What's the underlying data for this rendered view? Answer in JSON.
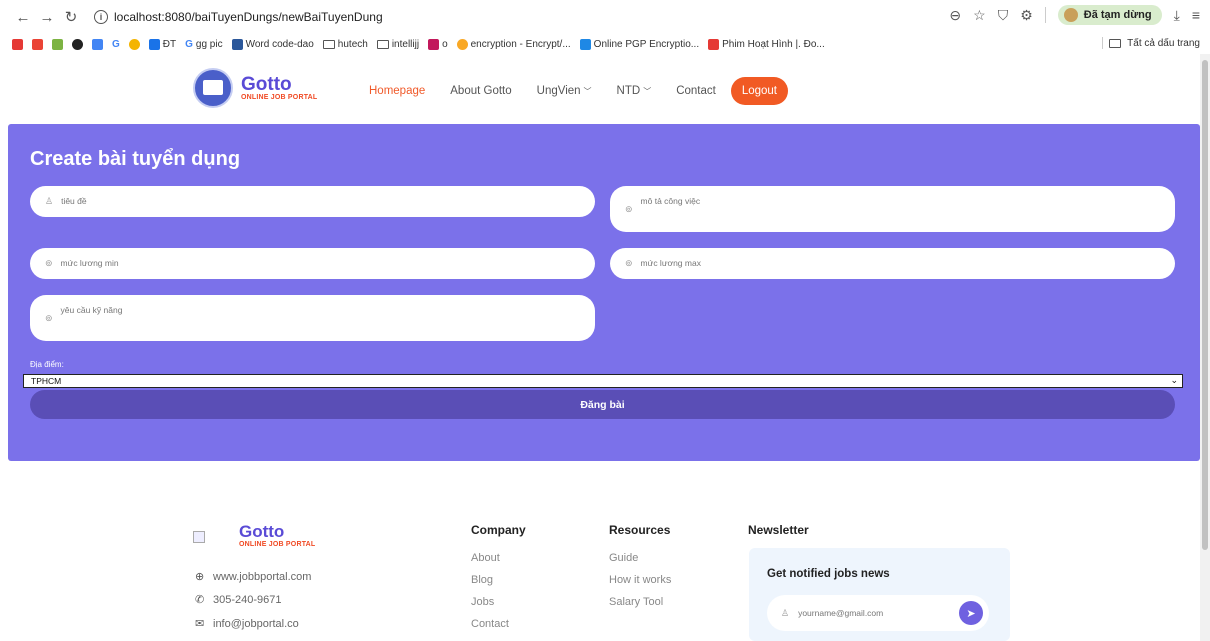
{
  "browser": {
    "url": "localhost:8080/baiTuyenDungs/newBaiTuyenDung",
    "profile_status": "Đã tạm dừng",
    "bookmarks": [
      "G",
      "ĐT",
      "gg pic",
      "Word code-dao",
      "hutech",
      "intellijj",
      "o",
      "encryption - Encrypt/...",
      "Online PGP Encryptio...",
      "Phim Hoạt Hình |. Đo..."
    ],
    "all_bookmarks": "Tất cả dấu trang"
  },
  "header": {
    "logo_name": "Gotto",
    "logo_sub": "ONLINE JOB PORTAL",
    "nav": [
      "Homepage",
      "About Gotto",
      "UngVien",
      "NTD",
      "Contact"
    ],
    "logout": "Logout"
  },
  "form": {
    "title": "Create bài tuyển dụng",
    "placeholders": {
      "title": "tiêu đề",
      "description": "mô tả công việc",
      "salary_min": "mức lương min",
      "salary_max": "mức lương max",
      "skills": "yêu cầu kỹ năng"
    },
    "location_label": "Địa điểm:",
    "location_value": "TPHCM",
    "submit": "Đăng bài"
  },
  "footer": {
    "logo_name": "Gotto",
    "logo_sub": "ONLINE JOB PORTAL",
    "website": "www.jobbportal.com",
    "phone": "305-240-9671",
    "email": "info@jobportal.co",
    "company": {
      "heading": "Company",
      "links": [
        "About",
        "Blog",
        "Jobs",
        "Contact"
      ]
    },
    "resources": {
      "heading": "Resources",
      "links": [
        "Guide",
        "How it works",
        "Salary Tool"
      ]
    },
    "newsletter": {
      "heading": "Newsletter",
      "box_title": "Get notified jobs news",
      "placeholder": "yourname@gmail.com"
    }
  },
  "colors": {
    "panel": "#7b71ea",
    "submit": "#5a4eb6",
    "accent": "#f15a24",
    "brand": "#5a4bd6"
  }
}
